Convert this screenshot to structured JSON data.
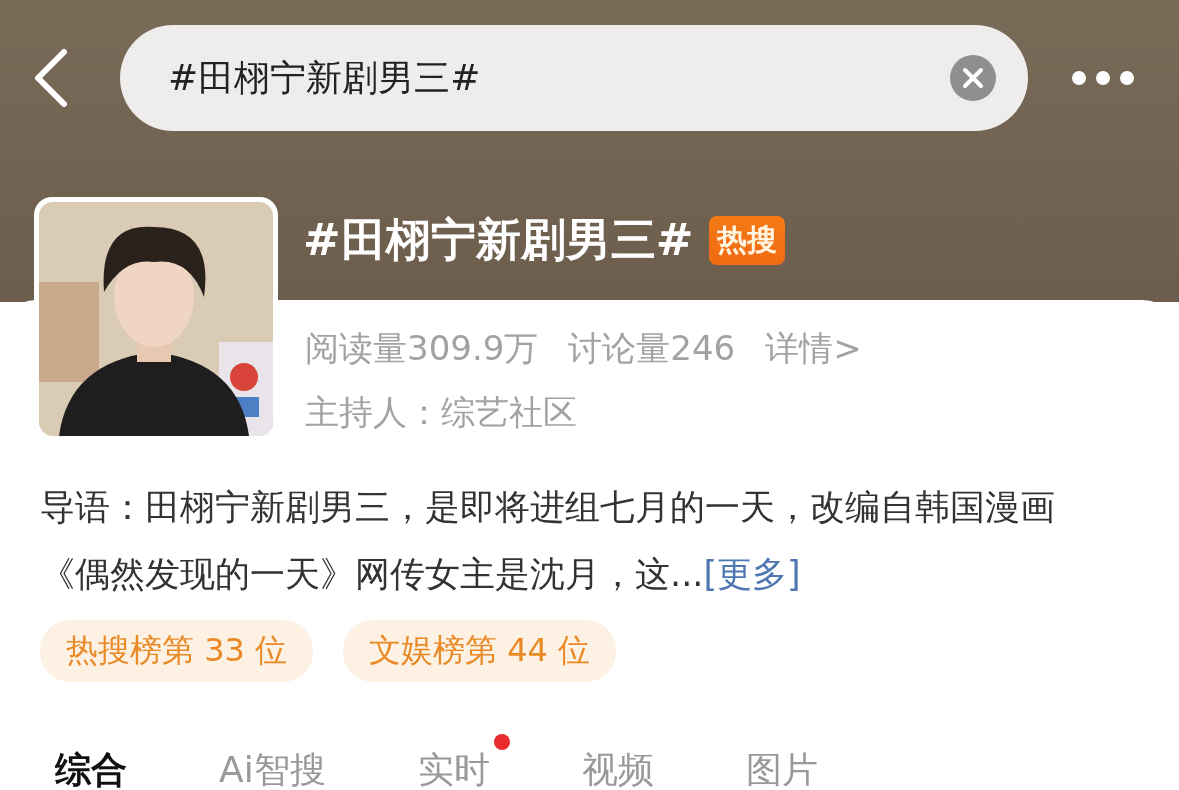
{
  "search": {
    "value": "#田栩宁新剧男三#"
  },
  "topic": {
    "title": "#田栩宁新剧男三#",
    "badge": "热搜",
    "stats": [
      "阅读量309.9万",
      "讨论量246",
      "详情>"
    ],
    "host": "主持人：综艺社区"
  },
  "intro": {
    "text": "导语：田栩宁新剧男三，是即将进组七月的一天，改编自韩国漫画《偶然发现的一天》网传女主是沈月，这...",
    "more": "[更多]"
  },
  "rank_tags": [
    "热搜榜第 33 位",
    "文娱榜第 44 位"
  ],
  "tabs": [
    {
      "label": "综合",
      "selected": true,
      "dot": false
    },
    {
      "label": "Ai智搜",
      "selected": false,
      "dot": false
    },
    {
      "label": "实时",
      "selected": false,
      "dot": true
    },
    {
      "label": "视频",
      "selected": false,
      "dot": false
    },
    {
      "label": "图片",
      "selected": false,
      "dot": false
    }
  ]
}
